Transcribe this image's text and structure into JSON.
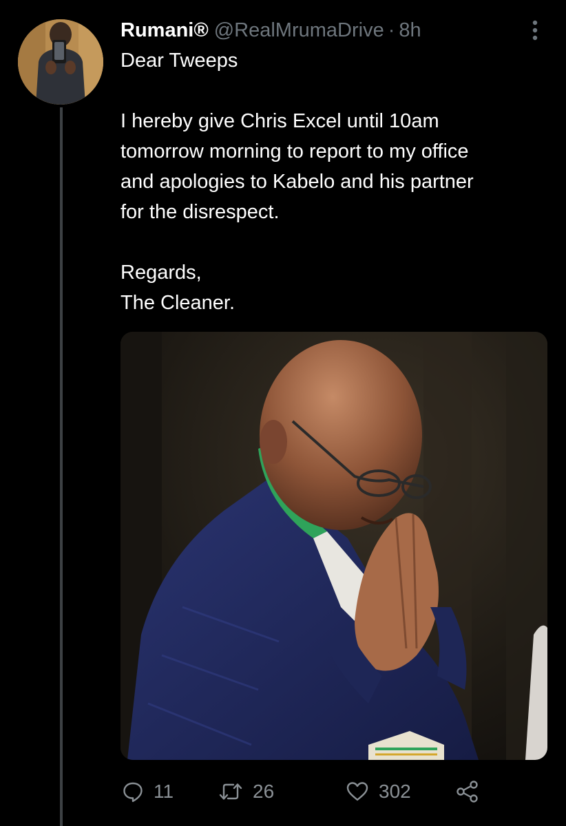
{
  "tweet": {
    "author_name": "Rumani®",
    "handle": "@RealMrumaDrive",
    "separator": "·",
    "time": "8h",
    "text_lines": [
      "Dear Tweeps",
      "",
      "I hereby give Chris Excel until 10am",
      "tomorrow morning to report to my office",
      "and apologies to Kabelo and his partner",
      "for the disrespect.",
      "",
      "Regards,",
      "The Cleaner."
    ],
    "reply_count": "11",
    "retweet_count": "26",
    "like_count": "302"
  },
  "icons": {
    "more": "more-vertical-icon",
    "reply": "reply-icon",
    "retweet": "retweet-icon",
    "like": "heart-icon",
    "share": "share-icon"
  },
  "colors": {
    "background": "#000000",
    "text": "#ffffff",
    "secondary_text": "#6e767d",
    "action_icon": "#8b9196",
    "thread_line": "#3d4144"
  }
}
